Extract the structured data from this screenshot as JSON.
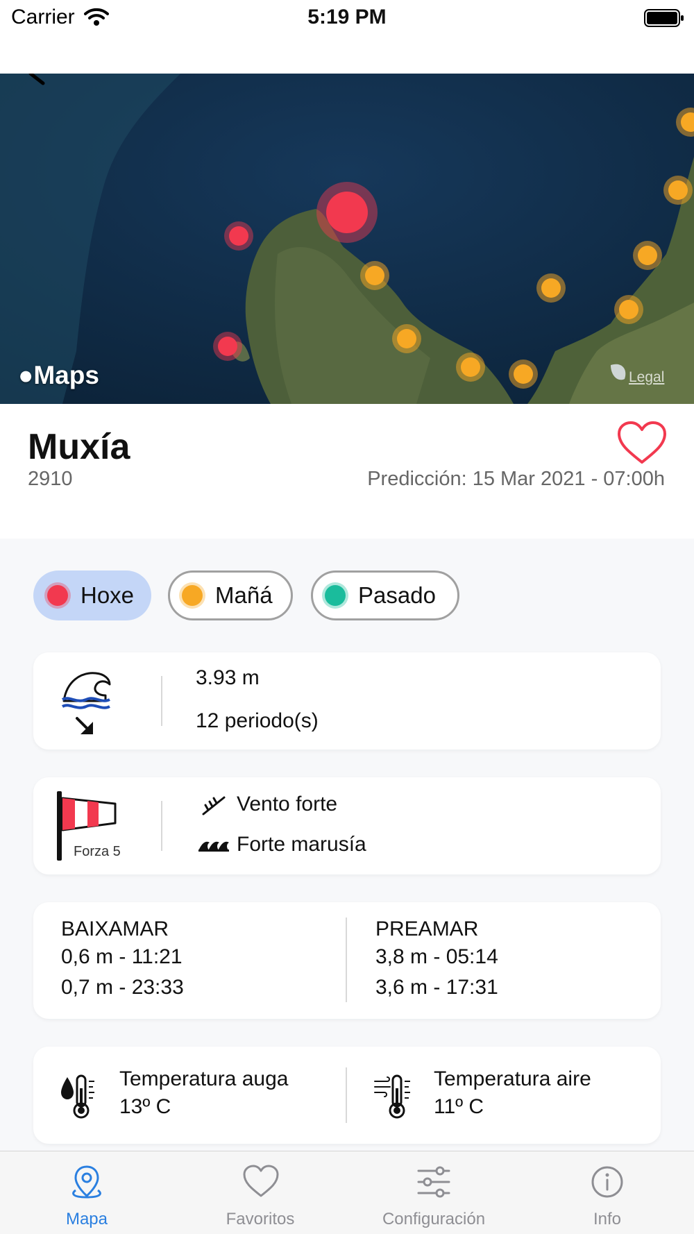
{
  "status_bar": {
    "carrier": "Carrier",
    "time": "5:19 PM"
  },
  "map": {
    "logo_text": "Maps",
    "legal_label": "Legal",
    "marker_colors": {
      "today": "#f2394f",
      "tomorrow": "#f7a824",
      "after": "#1abc9c"
    }
  },
  "location": {
    "name": "Muxía",
    "code": "2910",
    "prediction": "Predicción: 15 Mar 2021 - 07:00h"
  },
  "day_filter": [
    {
      "label": "Hoxe",
      "color": "#f2394f",
      "selected": true
    },
    {
      "label": "Mañá",
      "color": "#f7a824",
      "selected": false
    },
    {
      "label": "Pasado",
      "color": "#1abc9c",
      "selected": false
    }
  ],
  "waves": {
    "icon": "wave-icon",
    "direction_icon": "arrow-down-right-icon",
    "height": "3.93 m",
    "period": "12 periodo(s)"
  },
  "wind": {
    "icon": "windsock-icon",
    "force_label": "Forza 5",
    "wind_desc": "Vento forte",
    "sea_desc": "Forte marusía"
  },
  "tides": {
    "low_title": "BAIXAMAR",
    "low": [
      "0,6 m - 11:21",
      "0,7 m - 23:33"
    ],
    "high_title": "PREAMAR",
    "high": [
      "3,8 m - 05:14",
      "3,6 m - 17:31"
    ]
  },
  "temperature": {
    "water_label": "Temperatura auga",
    "water_value": "13º C",
    "air_label": "Temperatura aire",
    "air_value": "11º C"
  },
  "tabs": [
    {
      "label": "Mapa",
      "icon": "map-pin-icon",
      "active": true
    },
    {
      "label": "Favoritos",
      "icon": "heart-icon",
      "active": false
    },
    {
      "label": "Configuración",
      "icon": "sliders-icon",
      "active": false
    },
    {
      "label": "Info",
      "icon": "info-icon",
      "active": false
    }
  ]
}
